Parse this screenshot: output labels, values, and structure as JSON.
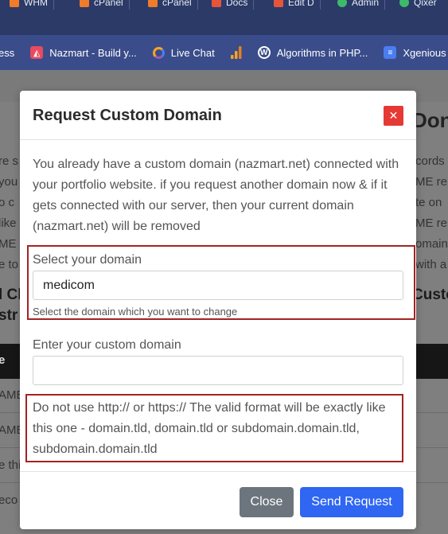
{
  "browser": {
    "tabs": [
      {
        "label": "WHM",
        "color": "#f07b2a"
      },
      {
        "label": "cPanel",
        "color": "#f07b2a"
      },
      {
        "label": "cPanel",
        "color": "#f07b2a"
      },
      {
        "label": "Docs",
        "color": "#e6553a"
      },
      {
        "label": "Edit D",
        "color": "#e6553a"
      },
      {
        "label": "Admin",
        "color": "#3dbb6b"
      },
      {
        "label": "Qixer",
        "color": "#3dbb6b"
      }
    ],
    "bookmarks": [
      {
        "label": "ess",
        "icon": "bookmark-icon",
        "color": "#3a4c8a"
      },
      {
        "label": "Nazmart - Build y...",
        "icon": "nazmart-logo-icon",
        "color": "#e84a5f"
      },
      {
        "label": "Live Chat",
        "icon": "live-chat-icon",
        "color": "#f5a623"
      },
      {
        "label": "",
        "icon": "analytics-icon",
        "color": "#f5a623"
      },
      {
        "label": "Algorithms in PHP...",
        "icon": "wordpress-icon",
        "color": "#ffffff"
      },
      {
        "label": "Xgenious press",
        "icon": "document-icon",
        "color": "#4a7df0"
      }
    ]
  },
  "background": {
    "heading_right": "Don",
    "left_fragments": [
      "re s",
      "you",
      "o c",
      "like",
      "ME",
      "e to"
    ],
    "right_fragments": [
      "cords",
      "ME re",
      "te on",
      "ME re",
      "omain",
      "with a"
    ],
    "left_bold": [
      "l Cl",
      "str"
    ],
    "right_bold": "Custo",
    "table_header_left": "e",
    "rows_left": [
      "AME",
      "AME",
      "e thi",
      "eco"
    ]
  },
  "modal": {
    "title": "Request Custom Domain",
    "close_symbol": "✕",
    "notice": "You already have a custom domain (nazmart.net) connected with your portfolio website. if you request another domain now & if it gets connected with our server, then your current domain (nazmart.net) will be removed",
    "select_domain": {
      "label": "Select your domain",
      "value": "medicom",
      "help": "Select the domain which you want to change"
    },
    "custom_domain": {
      "label": "Enter your custom domain",
      "value": "",
      "placeholder": ""
    },
    "warning": "Do not use http:// or https:// The valid format will be exactly like this one - domain.tld, domain.tld or subdomain.domain.tld, subdomain.domain.tld",
    "buttons": {
      "close": "Close",
      "send": "Send Request"
    },
    "colors": {
      "danger": "#e53935",
      "primary": "#2f66f2",
      "secondary": "#6c757d",
      "highlight_border": "#a32323"
    }
  }
}
